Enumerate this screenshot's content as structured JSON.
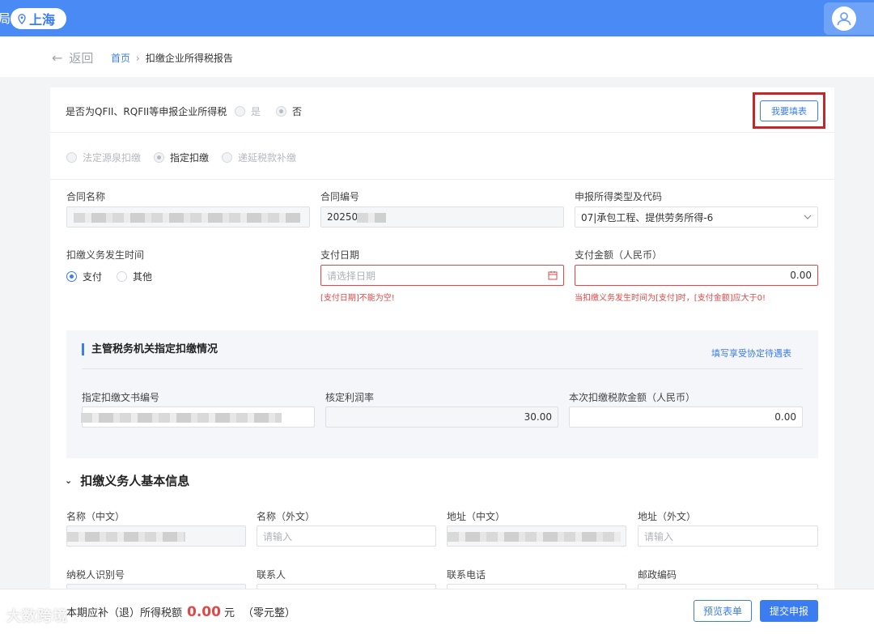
{
  "topbar": {
    "edge_char": "局",
    "location": "上海"
  },
  "subhead": {
    "back_label": "返回",
    "breadcrumb_home": "首页",
    "breadcrumb_sep": "›",
    "breadcrumb_current": "扣缴企业所得税报告"
  },
  "qfii": {
    "label": "是否为QFII、RQFII等申报企业所得税",
    "option_yes": "是",
    "option_no": "否",
    "selected": "否",
    "fill_button": "我要填表"
  },
  "withholding_type": {
    "options": [
      "法定源泉扣缴",
      "指定扣缴",
      "递延税款补缴"
    ],
    "selected": "指定扣缴"
  },
  "contract": {
    "name_label": "合同名称",
    "number_label": "合同编号",
    "number_value": "20250",
    "income_type_label": "申报所得类型及代码",
    "income_type_value": "07|承包工程、提供劳务所得-6"
  },
  "payment": {
    "occur_time_label": "扣缴义务发生时间",
    "occur_options": [
      "支付",
      "其他"
    ],
    "occur_selected": "支付",
    "date_label": "支付日期",
    "date_placeholder": "请选择日期",
    "date_error": "[支付日期]不能为空!",
    "amount_label": "支付金额（人民币）",
    "amount_value": "0.00",
    "amount_error": "当扣缴义务发生时间为[支付]时，[支付金额]应大于0!"
  },
  "authority_panel": {
    "title": "主管税务机关指定扣缴情况",
    "link": "填写享受协定待遇表",
    "doc_no_label": "指定扣缴文书编号",
    "profit_rate_label": "核定利润率",
    "profit_rate_value": "30.00",
    "tax_amount_label": "本次扣缴税款金额（人民币）",
    "tax_amount_value": "0.00"
  },
  "agent_info": {
    "section_title": "扣缴义务人基本信息",
    "name_cn_label": "名称（中文）",
    "name_foreign_label": "名称（外文）",
    "name_foreign_placeholder": "请输入",
    "addr_cn_label": "地址（中文）",
    "addr_foreign_label": "地址（外文）",
    "addr_foreign_placeholder": "请输入",
    "taxpayer_id_label": "纳税人识别号",
    "contact_label": "联系人",
    "phone_label": "联系电话",
    "postcode_label": "邮政编码"
  },
  "footer": {
    "summary_label": "本期应补（退）所得税额",
    "amount": "0.00",
    "unit": "元",
    "amount_words": "（零元整）",
    "preview_button": "预览表单",
    "submit_button": "提交申报",
    "watermark": "大数跨境"
  },
  "colors": {
    "primary": "#3b7cf0",
    "topbar": "#4a8af4",
    "error": "#e04848",
    "highlight_box": "#c0282a"
  }
}
